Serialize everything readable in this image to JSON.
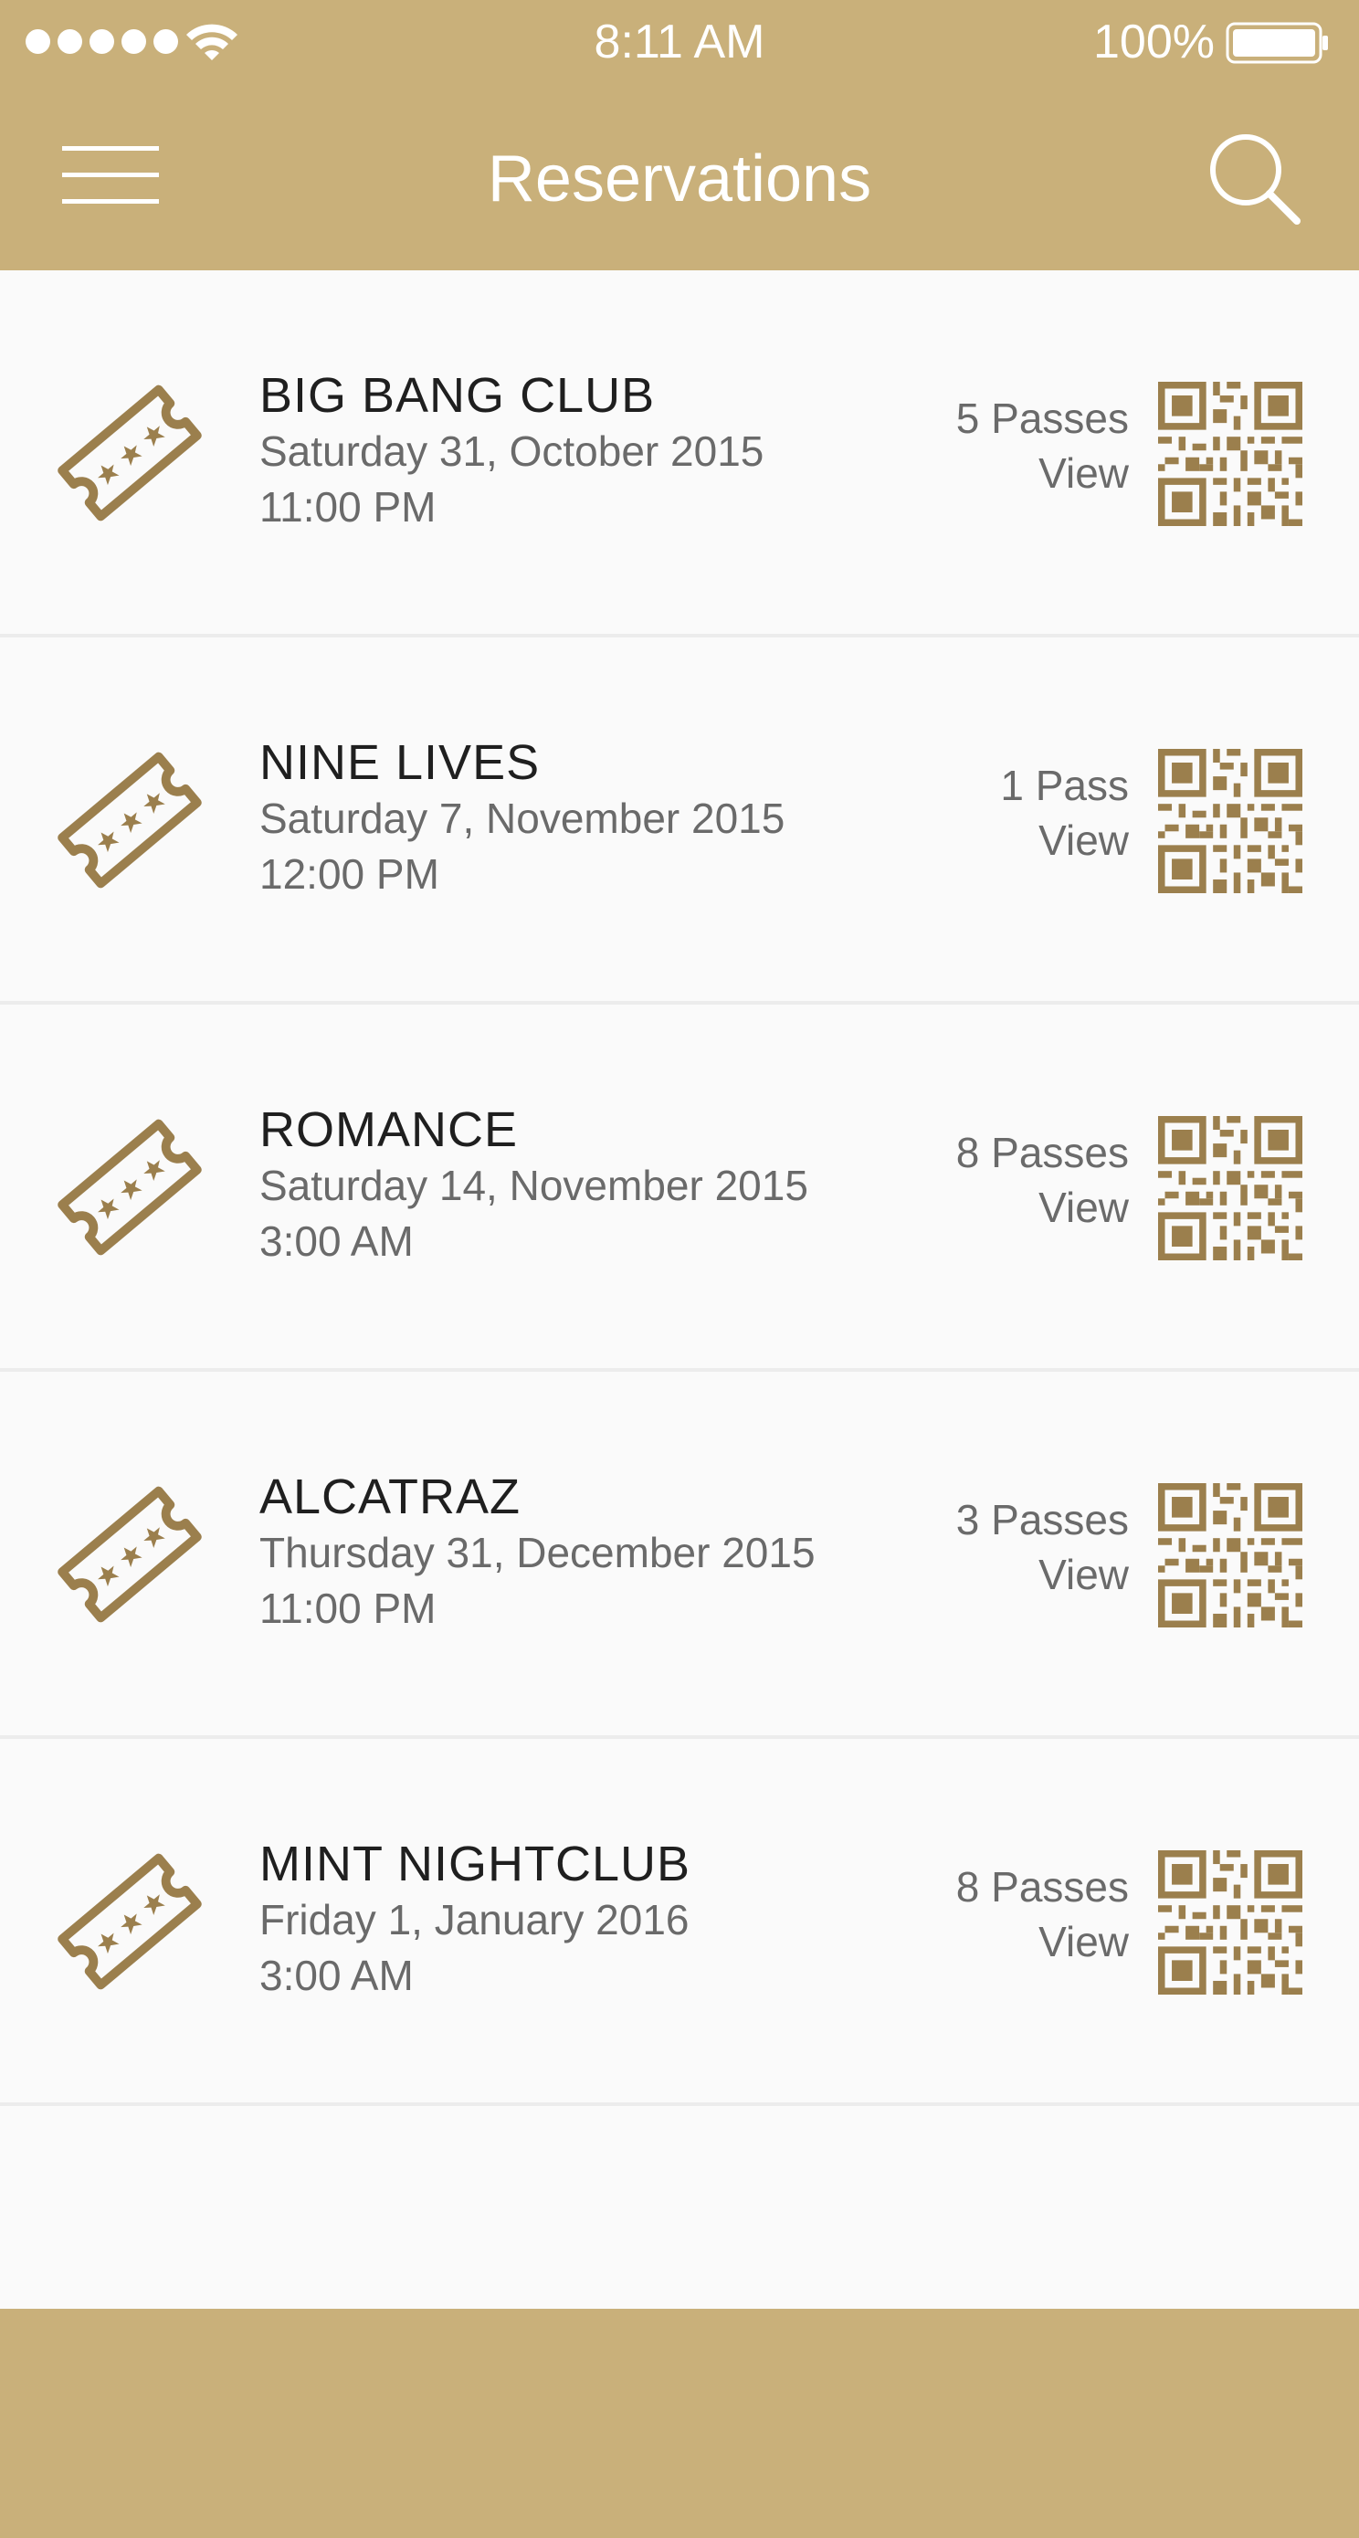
{
  "status_bar": {
    "time": "8:11 AM",
    "battery": "100%"
  },
  "header": {
    "title": "Reservations"
  },
  "reservations": [
    {
      "venue": "BIG BANG CLUB",
      "date": "Saturday 31, October 2015",
      "time": "11:00 PM",
      "passes": "5 Passes",
      "view": "View"
    },
    {
      "venue": "NINE LIVES",
      "date": "Saturday 7, November 2015",
      "time": "12:00 PM",
      "passes": "1 Pass",
      "view": "View"
    },
    {
      "venue": "ROMANCE",
      "date": "Saturday 14, November 2015",
      "time": "3:00 AM",
      "passes": "8 Passes",
      "view": "View"
    },
    {
      "venue": "ALCATRAZ",
      "date": "Thursday 31, December 2015",
      "time": "11:00 PM",
      "passes": "3 Passes",
      "view": "View"
    },
    {
      "venue": "MINT NIGHTCLUB",
      "date": "Friday 1, January 2016",
      "time": "3:00 AM",
      "passes": "8 Passes",
      "view": "View"
    }
  ],
  "icons": {
    "menu": "menu-icon",
    "search": "search-icon",
    "ticket": "ticket-icon",
    "qr": "qr-code-icon"
  },
  "colors": {
    "brand": "#c9b07a",
    "icon": "#9b7f4d",
    "background": "#fafafa"
  }
}
